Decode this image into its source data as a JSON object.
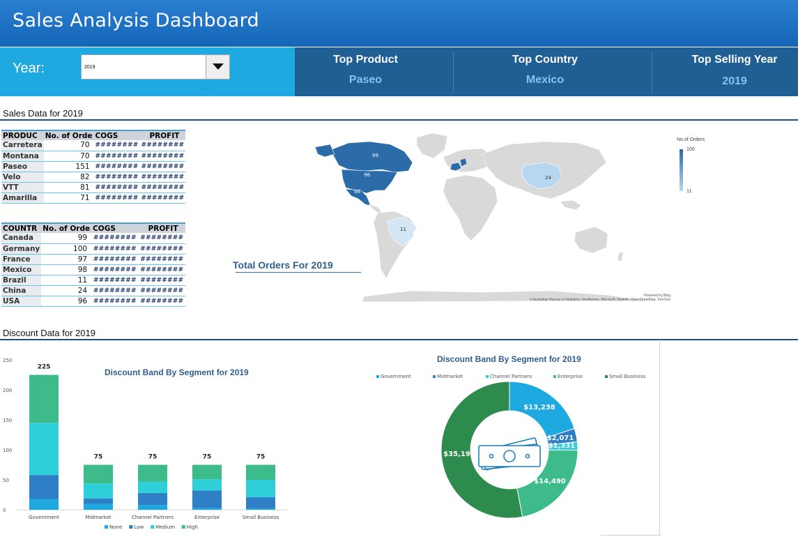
{
  "header": {
    "title": "Sales Analysis Dashboard"
  },
  "filter": {
    "label": "Year:",
    "value": "2019"
  },
  "kpis": [
    {
      "title": "Top Product",
      "value": "Paseo"
    },
    {
      "title": "Top Country",
      "value": "Mexico"
    },
    {
      "title": "Top Selling Year",
      "value": "2019"
    }
  ],
  "sales": {
    "section_title": "Sales Data for 2019",
    "product_table": {
      "headers": [
        "PRODUC",
        "No. of Orde",
        "COGS",
        "PROFIT"
      ],
      "rows": [
        [
          "Carretera",
          "70",
          "########",
          "########"
        ],
        [
          "Montana",
          "70",
          "########",
          "########"
        ],
        [
          "Paseo",
          "151",
          "########",
          "########"
        ],
        [
          "Velo",
          "82",
          "########",
          "########"
        ],
        [
          "VTT",
          "81",
          "########",
          "########"
        ],
        [
          "Amarilla",
          "71",
          "########",
          "########"
        ]
      ]
    },
    "country_table": {
      "headers": [
        "COUNTR",
        "No. of Orde",
        "COGS",
        "PROFIT"
      ],
      "rows": [
        [
          "Canada",
          "99",
          "########",
          "########"
        ],
        [
          "Germany",
          "100",
          "########",
          "########"
        ],
        [
          "France",
          "97",
          "########",
          "########"
        ],
        [
          "Mexico",
          "98",
          "########",
          "########"
        ],
        [
          "Brazil",
          "11",
          "########",
          "########"
        ],
        [
          "China",
          "24",
          "########",
          "########"
        ],
        [
          "USA",
          "96",
          "########",
          "########"
        ]
      ]
    },
    "map": {
      "title": "Total Orders For 2019",
      "legend_title": "No.of Orders",
      "legend_max": "100",
      "legend_min": "11",
      "labels": {
        "canada": "99",
        "usa": "96",
        "mexico": "98",
        "china": "24",
        "brazil": "11"
      },
      "attribution_1": "Powered by Bing",
      "attribution_2": "© Australian Bureau of Statistics, GeoNames, Microsoft, Navinfo, OpenStreetMap, TomTom",
      "colors": {
        "high": "#2b6ba8",
        "low": "#b7d7f0",
        "land": "#d9d9d9"
      }
    }
  },
  "discount": {
    "section_title": "Discount Data for 2019"
  },
  "chart_data": [
    {
      "type": "bar",
      "stacked": true,
      "title": "Discount Band By Segment for 2019",
      "categories": [
        "Government",
        "Midmarket",
        "Channel Partners",
        "Enterprise",
        "Small Business"
      ],
      "series": [
        {
          "name": "None",
          "color": "#1fa9e1",
          "values": [
            18,
            10,
            8,
            3,
            2
          ]
        },
        {
          "name": "Low",
          "color": "#2e7fc6",
          "values": [
            40,
            9,
            20,
            29,
            19
          ]
        },
        {
          "name": "Medium",
          "color": "#2ecfd9",
          "values": [
            87,
            25,
            19,
            19,
            29
          ]
        },
        {
          "name": "High",
          "color": "#3dbb8a",
          "values": [
            80,
            31,
            28,
            24,
            25
          ]
        }
      ],
      "totals": [
        "225",
        "75",
        "75",
        "75",
        "75"
      ],
      "yticks": [
        "0",
        "50",
        "100",
        "150",
        "200",
        "250"
      ],
      "ylim": [
        0,
        250
      ]
    },
    {
      "type": "pie",
      "donut": true,
      "title": "Discount Band By Segment for 2019",
      "categories": [
        "Government",
        "Midmarket",
        "Channel Partners",
        "Enterprise",
        "Small Business"
      ],
      "values": [
        13238,
        2071,
        1331,
        14490,
        35193
      ],
      "labels": [
        "$13,238",
        "$2,071",
        "$1,331",
        "$14,490",
        "$35,193"
      ],
      "colors": [
        "#1fa9e1",
        "#2e7fc6",
        "#2ecfd9",
        "#3dbb8a",
        "#2e8b4e"
      ]
    }
  ]
}
